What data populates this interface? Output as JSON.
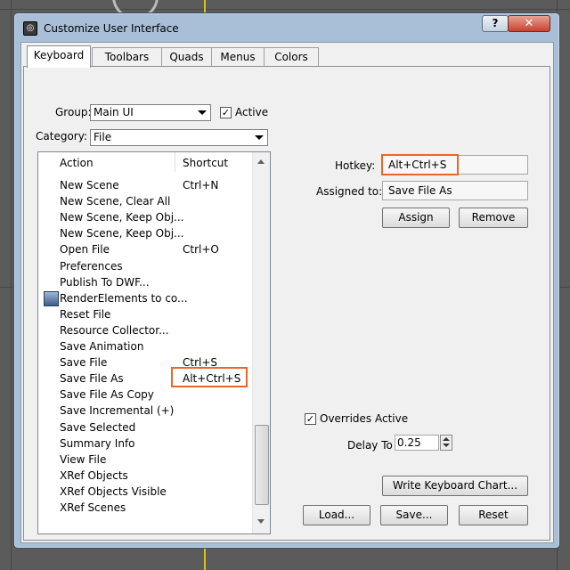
{
  "window": {
    "title": "Customize User Interface",
    "help_label": "?",
    "close_label": "✕"
  },
  "tabs": [
    "Keyboard",
    "Toolbars",
    "Quads",
    "Menus",
    "Colors"
  ],
  "group": {
    "label": "Group:",
    "value": "Main UI"
  },
  "active": {
    "label": "Active",
    "checked": true
  },
  "category": {
    "label": "Category:",
    "value": "File"
  },
  "list": {
    "headers": {
      "action": "Action",
      "shortcut": "Shortcut"
    },
    "rows": [
      {
        "action": "New Scene",
        "shortcut": "Ctrl+N"
      },
      {
        "action": "New Scene, Clear All",
        "shortcut": ""
      },
      {
        "action": "New Scene, Keep Obj...",
        "shortcut": ""
      },
      {
        "action": "New Scene, Keep Obj...",
        "shortcut": ""
      },
      {
        "action": "Open File",
        "shortcut": "Ctrl+O"
      },
      {
        "action": "Preferences",
        "shortcut": ""
      },
      {
        "action": "Publish To DWF...",
        "shortcut": ""
      },
      {
        "action": "RenderElements to co...",
        "shortcut": "",
        "icon": "render-elements-icon"
      },
      {
        "action": "Reset File",
        "shortcut": ""
      },
      {
        "action": "Resource Collector...",
        "shortcut": ""
      },
      {
        "action": "Save Animation",
        "shortcut": ""
      },
      {
        "action": "Save File",
        "shortcut": "Ctrl+S"
      },
      {
        "action": "Save File As",
        "shortcut": "Alt+Ctrl+S"
      },
      {
        "action": "Save File As Copy",
        "shortcut": ""
      },
      {
        "action": "Save Incremental (+)",
        "shortcut": ""
      },
      {
        "action": "Save Selected",
        "shortcut": ""
      },
      {
        "action": "Summary Info",
        "shortcut": ""
      },
      {
        "action": "View File",
        "shortcut": ""
      },
      {
        "action": "XRef Objects",
        "shortcut": ""
      },
      {
        "action": "XRef Objects Visible",
        "shortcut": ""
      },
      {
        "action": "XRef Scenes",
        "shortcut": ""
      }
    ]
  },
  "hotkey": {
    "label": "Hotkey:",
    "value": "Alt+Ctrl+S"
  },
  "assigned_to": {
    "label": "Assigned to:",
    "value": "Save File As"
  },
  "buttons": {
    "assign": "Assign",
    "remove": "Remove",
    "write_chart": "Write Keyboard Chart...",
    "load": "Load...",
    "save": "Save...",
    "reset": "Reset"
  },
  "overrides": {
    "label": "Overrides Active",
    "checked": true
  },
  "delay": {
    "label": "Delay To",
    "value": "0.25"
  },
  "highlight_color": "#e8672a"
}
